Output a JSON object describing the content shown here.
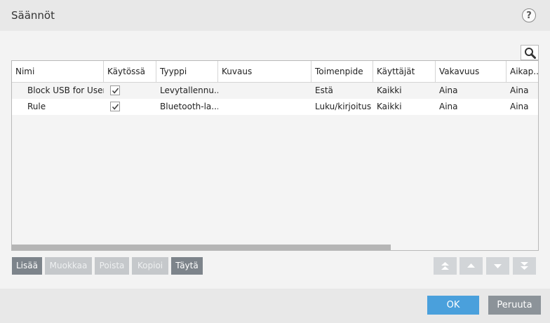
{
  "window": {
    "title": "Säännöt",
    "help_label": "?"
  },
  "table": {
    "columns": [
      "Nimi",
      "Käytössä",
      "Tyyppi",
      "Kuvaus",
      "Toimenpide",
      "Käyttäjät",
      "Vakavuus",
      "Aikap..."
    ],
    "rows": [
      {
        "name": "Block USB for User",
        "enabled": true,
        "type": "Levytallennu...",
        "description": "",
        "action": "Estä",
        "users": "Kaikki",
        "severity": "Aina",
        "schedule": "Aina"
      },
      {
        "name": "Rule",
        "enabled": true,
        "type": "Bluetooth-la...",
        "description": "",
        "action": "Luku/kirjoitus",
        "users": "Kaikki",
        "severity": "Aina",
        "schedule": "Aina"
      }
    ]
  },
  "toolbar": {
    "add": "Lisää",
    "edit": "Muokkaa",
    "delete": "Poista",
    "copy": "Kopioi",
    "fill": "Täytä"
  },
  "footer": {
    "ok": "OK",
    "cancel": "Peruuta"
  },
  "colors": {
    "ok_button": "#4aa0dc",
    "active_button": "#7d848b",
    "disabled_button": "#c5c8cb"
  }
}
